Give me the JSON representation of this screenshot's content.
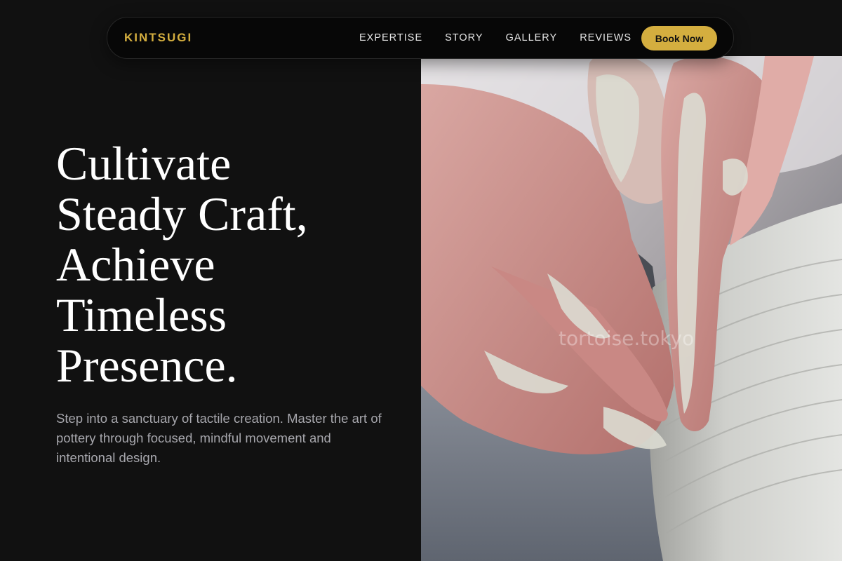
{
  "brand": {
    "name": "KINTSUGI",
    "color": "#d4ae3f"
  },
  "nav": {
    "links": [
      "EXPERTISE",
      "STORY",
      "GALLERY",
      "REVIEWS"
    ],
    "cta_label": "Book Now"
  },
  "hero": {
    "headline_lines": [
      "Cultivate",
      "Steady Craft,",
      "Achieve",
      "Timeless",
      "Presence."
    ],
    "subtext": "Step into a sanctuary of tactile creation. Master the art of pottery through focused, mindful movement and intentional design."
  },
  "photo": {
    "watermark": "tortoise.tokyo"
  },
  "colors": {
    "background": "#111111",
    "accent": "#d4ae3f",
    "text": "#ffffff",
    "muted": "#a7a7ad"
  }
}
